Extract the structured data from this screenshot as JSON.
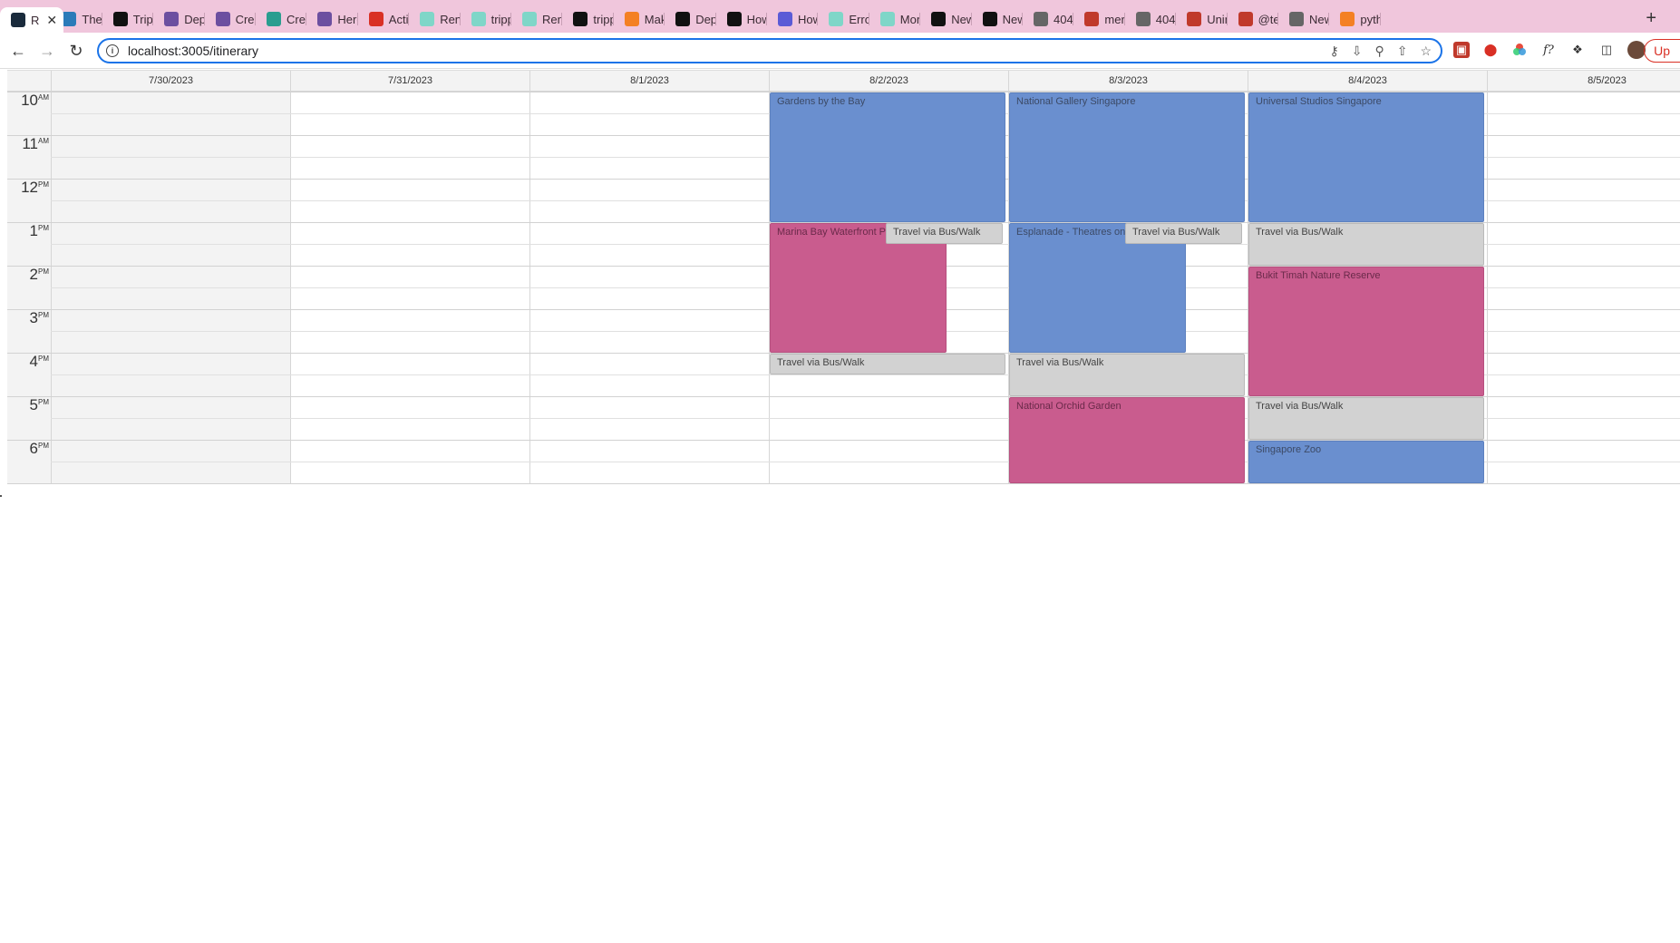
{
  "browser": {
    "tabs": [
      {
        "label": "R",
        "icon": "app-icon",
        "color": "#1a2b3c",
        "active": true
      },
      {
        "label": "The",
        "icon": "st-icon",
        "color": "#2b7bb9"
      },
      {
        "label": "Tripp",
        "icon": "github-icon",
        "color": "#111111"
      },
      {
        "label": "Depl",
        "icon": "heroku-icon",
        "color": "#6c4fa0"
      },
      {
        "label": "Crea",
        "icon": "heroku-icon",
        "color": "#6c4fa0"
      },
      {
        "label": "Crea",
        "icon": "diamond-icon",
        "color": "#2a9d8f"
      },
      {
        "label": "Hero",
        "icon": "heroku-icon",
        "color": "#6c4fa0"
      },
      {
        "label": "Acti",
        "icon": "gmail-icon",
        "color": "#d93025"
      },
      {
        "label": "Renc",
        "icon": "page-icon",
        "color": "#7fd6c8"
      },
      {
        "label": "tripp",
        "icon": "page-icon",
        "color": "#7fd6c8"
      },
      {
        "label": "Renc",
        "icon": "page-icon",
        "color": "#7fd6c8"
      },
      {
        "label": "tripp",
        "icon": "circle-logo-icon",
        "color": "#111111"
      },
      {
        "label": "Mak",
        "icon": "stack-icon",
        "color": "#f48024"
      },
      {
        "label": "Depl",
        "icon": "dev-icon",
        "color": "#111111"
      },
      {
        "label": "How",
        "icon": "a-logo-icon",
        "color": "#111111"
      },
      {
        "label": "How",
        "icon": "video-icon",
        "color": "#5b5bd6"
      },
      {
        "label": "Error",
        "icon": "page-icon",
        "color": "#7fd6c8"
      },
      {
        "label": "Mon",
        "icon": "page-icon",
        "color": "#7fd6c8"
      },
      {
        "label": "New",
        "icon": "triangle-logo-icon",
        "color": "#111111"
      },
      {
        "label": "New",
        "icon": "triangle-logo-icon",
        "color": "#111111"
      },
      {
        "label": "404",
        "icon": "globe-icon",
        "color": "#666666"
      },
      {
        "label": "merg",
        "icon": "git-icon",
        "color": "#c0392b"
      },
      {
        "label": "404",
        "icon": "globe-icon",
        "color": "#666666"
      },
      {
        "label": "Unin",
        "icon": "red-square-icon",
        "color": "#c0392b"
      },
      {
        "label": "@te",
        "icon": "red-square-icon",
        "color": "#c0392b"
      },
      {
        "label": "New",
        "icon": "globe-icon",
        "color": "#666666"
      },
      {
        "label": "pyth",
        "icon": "stack-icon",
        "color": "#f48024"
      }
    ],
    "url": "localhost:3005/itinerary",
    "update_label": "Up"
  },
  "calendar": {
    "days": [
      "7/30/2023",
      "7/31/2023",
      "8/1/2023",
      "8/2/2023",
      "8/3/2023",
      "8/4/2023",
      "8/5/2023"
    ],
    "hours": [
      {
        "h": "10",
        "ampm": "AM"
      },
      {
        "h": "11",
        "ampm": "AM"
      },
      {
        "h": "12",
        "ampm": "PM"
      },
      {
        "h": "1",
        "ampm": "PM"
      },
      {
        "h": "2",
        "ampm": "PM"
      },
      {
        "h": "3",
        "ampm": "PM"
      },
      {
        "h": "4",
        "ampm": "PM"
      },
      {
        "h": "5",
        "ampm": "PM"
      },
      {
        "h": "6",
        "ampm": "PM"
      }
    ],
    "events": [
      {
        "title": "Gardens by the Bay",
        "day": 3,
        "start": 10,
        "end": 13,
        "kind": "blue"
      },
      {
        "title": "Marina Bay Waterfront Pr",
        "day": 3,
        "start": 13,
        "end": 16,
        "kind": "pink",
        "part": "left"
      },
      {
        "title": "Travel via Bus/Walk",
        "day": 3,
        "start": 13,
        "end": 13.5,
        "kind": "gray",
        "part": "right"
      },
      {
        "title": "Travel via Bus/Walk",
        "day": 3,
        "start": 16,
        "end": 16.5,
        "kind": "gray"
      },
      {
        "title": "National Gallery Singapore",
        "day": 4,
        "start": 10,
        "end": 13,
        "kind": "blue"
      },
      {
        "title": "Esplanade - Theatres on t",
        "day": 4,
        "start": 13,
        "end": 16,
        "kind": "blue",
        "part": "left"
      },
      {
        "title": "Travel via Bus/Walk",
        "day": 4,
        "start": 13,
        "end": 13.5,
        "kind": "gray",
        "part": "right"
      },
      {
        "title": "Travel via Bus/Walk",
        "day": 4,
        "start": 16,
        "end": 17,
        "kind": "gray"
      },
      {
        "title": "National Orchid Garden",
        "day": 4,
        "start": 17,
        "end": 19,
        "kind": "pink"
      },
      {
        "title": "Universal Studios Singapore",
        "day": 5,
        "start": 10,
        "end": 13,
        "kind": "blue"
      },
      {
        "title": "Travel via Bus/Walk",
        "day": 5,
        "start": 13,
        "end": 14,
        "kind": "gray"
      },
      {
        "title": "Bukit Timah Nature Reserve",
        "day": 5,
        "start": 14,
        "end": 17,
        "kind": "pink"
      },
      {
        "title": "Travel via Bus/Walk",
        "day": 5,
        "start": 17,
        "end": 18,
        "kind": "gray"
      },
      {
        "title": "Singapore Zoo",
        "day": 5,
        "start": 18,
        "end": 19,
        "kind": "blue"
      }
    ]
  }
}
